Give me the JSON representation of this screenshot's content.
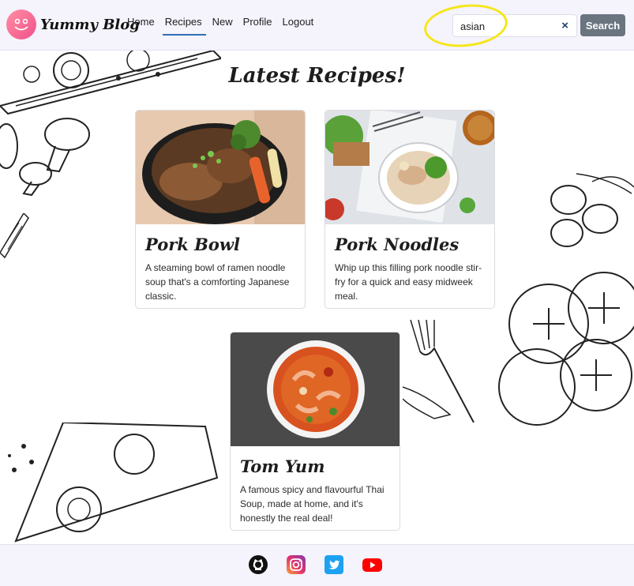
{
  "header": {
    "brand": "Yummy Blog",
    "logo_icon": "smiley-icon",
    "nav": [
      {
        "label": "Home",
        "active": false
      },
      {
        "label": "Recipes",
        "active": true
      },
      {
        "label": "New",
        "active": false
      },
      {
        "label": "Profile",
        "active": false
      },
      {
        "label": "Logout",
        "active": false
      }
    ],
    "search": {
      "value": "asian",
      "placeholder": "",
      "clear_symbol": "×",
      "button_label": "Search"
    }
  },
  "main": {
    "title": "Latest Recipes!",
    "recipes": [
      {
        "title": "Pork Bowl",
        "description": "A steaming bowl of ramen noodle soup that's a comforting Japanese classic."
      },
      {
        "title": "Pork Noodles",
        "description": "Whip up this filling pork noodle stir-fry for a quick and easy midweek meal."
      },
      {
        "title": "Tom Yum",
        "description": "A famous spicy and flavourful Thai Soup, made at home, and it's honestly the real deal!"
      }
    ]
  },
  "footer": {
    "icons": [
      "github-icon",
      "instagram-icon",
      "twitter-icon",
      "youtube-icon"
    ]
  },
  "colors": {
    "header_bg": "#f5f3fc",
    "accent": "#2f6fb5",
    "search_button": "#6b7580",
    "annotation": "#f5e61a"
  }
}
